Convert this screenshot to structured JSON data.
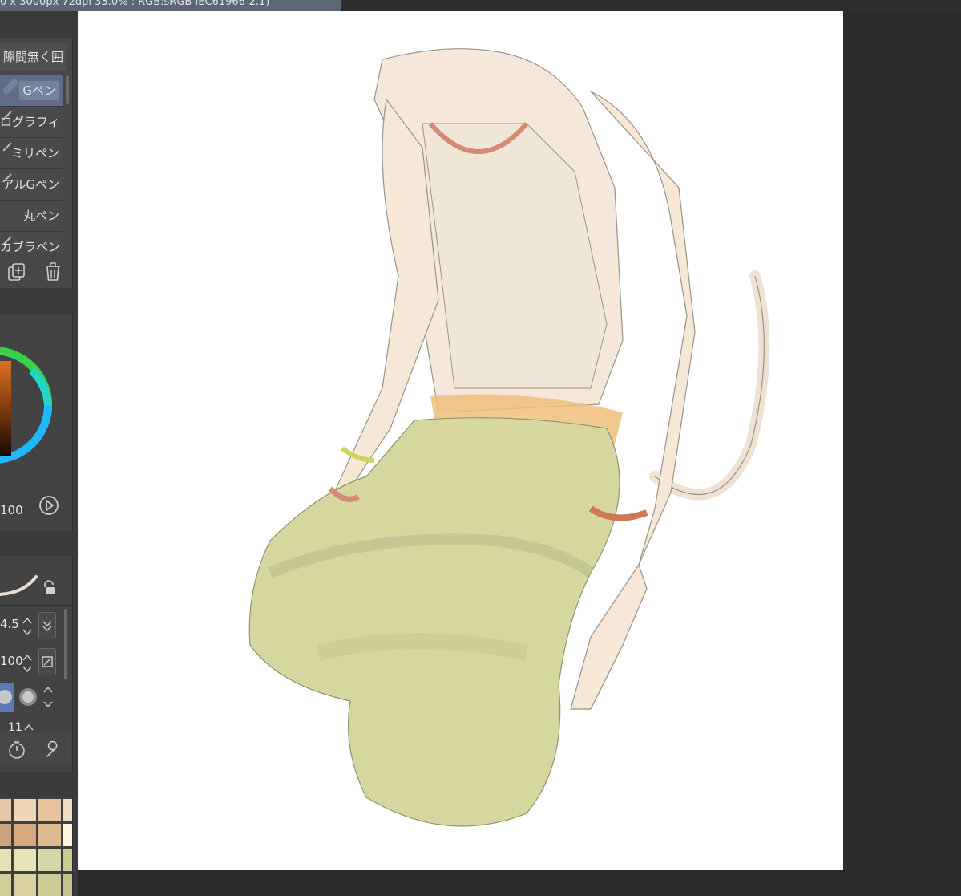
{
  "window": {
    "title": "0 x 3000px 72dpi 33.0% : RGB:sRGB IEC61966-2.1)"
  },
  "brush_panel": {
    "sub_tool_group": "隙間無く囲",
    "brushes": [
      {
        "label": "Gペン",
        "selected": true
      },
      {
        "label": "ログラフィ",
        "selected": false
      },
      {
        "label": "ミリペン",
        "selected": false
      },
      {
        "label": "アルGペン",
        "selected": false
      },
      {
        "label": "丸ペン",
        "selected": false
      },
      {
        "label": "カブラペン",
        "selected": false
      }
    ],
    "icons": [
      "duplicate-icon",
      "trash-icon"
    ]
  },
  "color_panel": {
    "value": "100",
    "colors": {
      "ring": "#1fb8ff",
      "current": "#c05a10"
    }
  },
  "tool_property": {
    "brush_size": "4.5",
    "opacity": "100",
    "stabilization": "11",
    "icons": [
      "lock-icon",
      "stopwatch-icon",
      "wrench-icon"
    ]
  },
  "palette": {
    "swatches": [
      "#e3c7a6",
      "#f0d7b7",
      "#e6c39d",
      "#f1dcc3",
      "#c9a47c",
      "#d5a97d",
      "#ddb98f",
      "#fbf2e0",
      "#e6e1b5",
      "#e8e2b6",
      "#d6d7a8",
      "#c8cc94",
      "#d2ce9b",
      "#d9d29f",
      "#cfcb95",
      "#c3c48d"
    ]
  },
  "canvas": {
    "background": "#ffffff"
  }
}
